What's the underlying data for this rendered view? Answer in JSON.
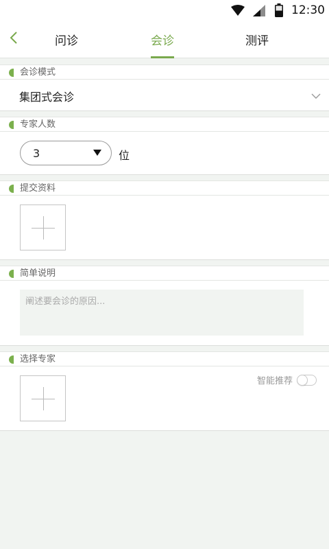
{
  "status_bar": {
    "time": "12:30",
    "icons": [
      "wifi-icon",
      "signal-icon",
      "battery-icon"
    ]
  },
  "nav": {
    "back_icon": "chevron-left-icon",
    "tabs": [
      {
        "label": "问诊",
        "active": false
      },
      {
        "label": "会诊",
        "active": true
      },
      {
        "label": "测评",
        "active": false
      }
    ]
  },
  "form": {
    "mode": {
      "title": "会诊模式",
      "value": "集团式会诊",
      "dropdown_icon": "chevron-down-icon"
    },
    "experts_count": {
      "title": "专家人数",
      "value": "3",
      "unit": "位"
    },
    "materials": {
      "title": "提交资料",
      "add_icon": "plus-icon"
    },
    "description": {
      "title": "简单说明",
      "placeholder": "阐述要会诊的原因..."
    },
    "select_experts": {
      "title": "选择专家",
      "smart_recommend_label": "智能推荐",
      "smart_recommend_on": false,
      "add_icon": "plus-icon"
    }
  },
  "colors": {
    "accent": "#79a94d",
    "background": "#f1f4f1"
  }
}
